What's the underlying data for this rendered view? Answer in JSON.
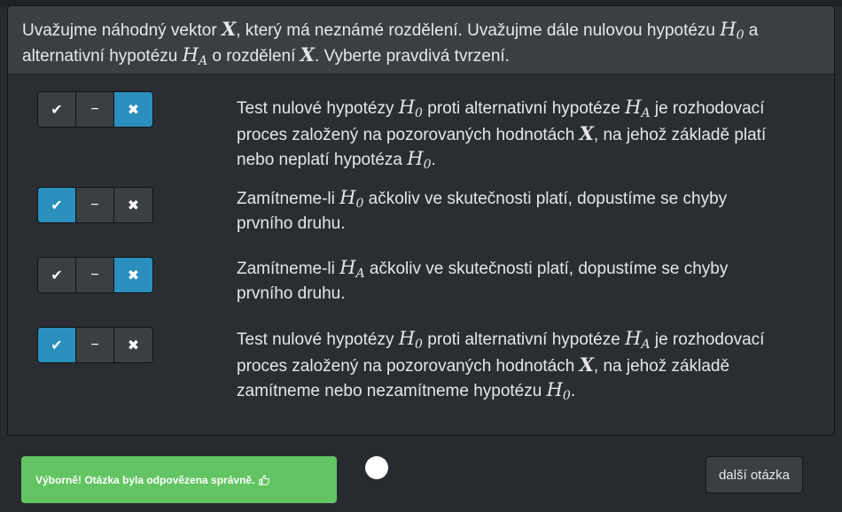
{
  "question": {
    "p1": "Uvažujme náhodný vektor ",
    "var_x": "X",
    "p2": ", který má neznámé rozdělení. Uvažujme dále nulovou hypotézu ",
    "h": "H",
    "sub0": "0",
    "p3": " a",
    "p4": "alternativní hypotézu ",
    "subA": "A",
    "p5": " o rozdělení ",
    "p6": ". Vyberte pravdivá tvrzení."
  },
  "toggle_symbols": {
    "true": "✔",
    "neutral": "−",
    "false": "✖"
  },
  "statements": [
    {
      "state": "false",
      "a": "Test nulové hypotézy ",
      "b": " proti alternativní hypotéze ",
      "c": " je rozhodovací",
      "d": "proces založený na pozorovaných hodnotách ",
      "e": ", na jehož základě platí",
      "f": "nebo neplatí hypotéza ",
      "g": "."
    },
    {
      "state": "true",
      "a": "Zamítneme-li ",
      "b": " ačkoliv ve skutečnosti platí, dopustíme se chyby",
      "c": "prvního druhu."
    },
    {
      "state": "false",
      "a": "Zamítneme-li ",
      "b": " ačkoliv ve skutečnosti platí, dopustíme se chyby",
      "c": "prvního druhu."
    },
    {
      "state": "true",
      "a": "Test nulové hypotézy ",
      "b": " proti alternativní hypotéze ",
      "c": " je rozhodovací",
      "d": "proces založený na pozorovaných hodnotách ",
      "e": ", na jehož základě",
      "f": "zamítneme nebo nezamítneme hypotézu ",
      "g": "."
    }
  ],
  "feedback": {
    "text": "Výborně! Otázka byla odpovězena správně."
  },
  "next_button": {
    "label": "další otázka"
  },
  "colors": {
    "active_toggle": "#2a8fbd",
    "success": "#62c462",
    "background": "#272b30"
  }
}
